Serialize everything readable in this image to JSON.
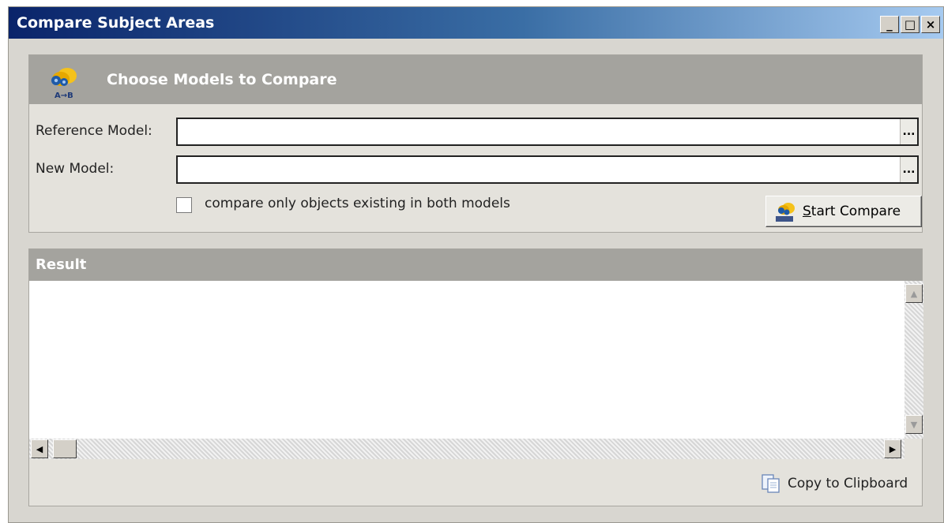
{
  "window": {
    "title": "Compare Subject Areas",
    "controls": {
      "minimize": "_",
      "maximize": "□",
      "close": "×"
    }
  },
  "choose_panel": {
    "header_label": "Choose Models to Compare",
    "logo_caption": "A→B",
    "reference_model": {
      "label": "Reference Model:",
      "value": "",
      "browse": "..."
    },
    "new_model": {
      "label": "New Model:",
      "value": "",
      "browse": "..."
    },
    "compare_only_checkbox": {
      "label": "compare only objects existing in both models",
      "checked": false
    },
    "start_button": {
      "mnemonic": "S",
      "label_rest": "tart Compare"
    }
  },
  "result_panel": {
    "header_label": "Result",
    "content": "",
    "copy_button_label": "Copy to Clipboard"
  },
  "colors": {
    "titlebar_start": "#0a246a",
    "titlebar_end": "#a6caf0",
    "panel_header": "#a4a39e",
    "window_bg": "#d8d6d0"
  },
  "icons": {
    "logo": "compare-models-icon",
    "start_button": "compare-icon",
    "copy_button": "clipboard-icon"
  }
}
